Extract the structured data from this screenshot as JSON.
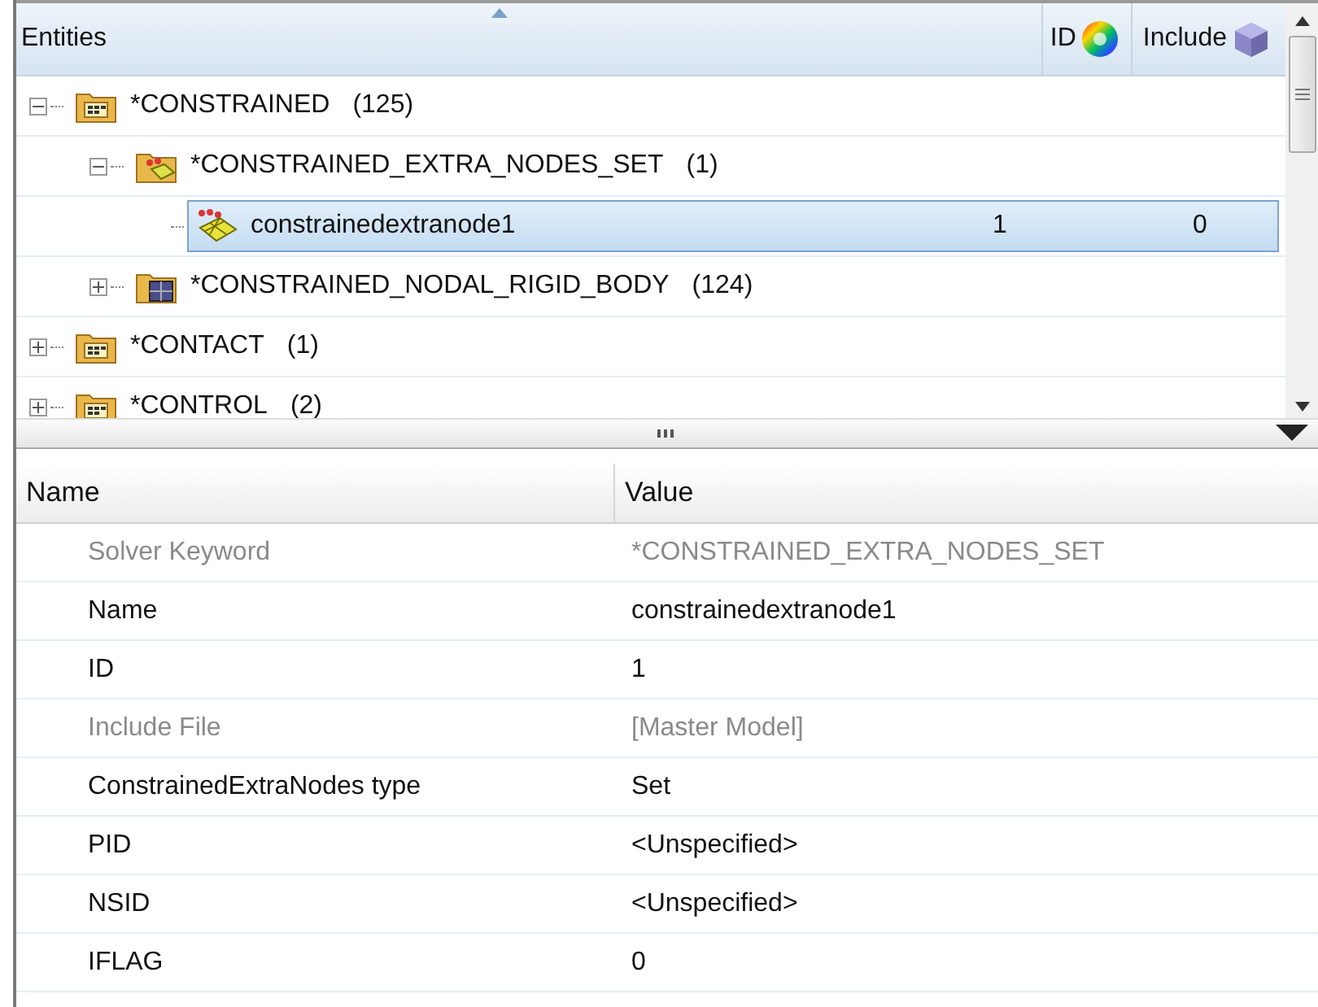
{
  "tree": {
    "columns": [
      {
        "label": "Entities",
        "sorted": true
      },
      {
        "label": "ID"
      },
      {
        "label": "Include"
      }
    ],
    "items": [
      {
        "label": "*CONSTRAINED",
        "count": "(125)",
        "kind": "folder",
        "expanded": true,
        "selected": false,
        "children": [
          {
            "label": "*CONSTRAINED_EXTRA_NODES_SET",
            "count": "(1)",
            "kind": "nodes-folder",
            "expanded": true,
            "selected": false,
            "children": [
              {
                "label": "constrainedextranode1",
                "kind": "nodes",
                "selected": true,
                "id": "1",
                "include": "0"
              }
            ]
          },
          {
            "label": "*CONSTRAINED_NODAL_RIGID_BODY",
            "count": "(124)",
            "kind": "body-folder",
            "expanded": false,
            "selected": false
          }
        ]
      },
      {
        "label": "*CONTACT",
        "count": "(1)",
        "kind": "folder",
        "expanded": false,
        "selected": false
      },
      {
        "label": "*CONTROL",
        "count": "(2)",
        "kind": "folder",
        "expanded": false,
        "selected": false
      }
    ]
  },
  "properties": {
    "columns": [
      "Name",
      "Value"
    ],
    "rows": [
      {
        "name": "Solver Keyword",
        "value": "*CONSTRAINED_EXTRA_NODES_SET",
        "disabled": true
      },
      {
        "name": "Name",
        "value": "constrainedextranode1",
        "disabled": false
      },
      {
        "name": "ID",
        "value": "1",
        "disabled": false
      },
      {
        "name": "Include File",
        "value": "[Master Model]",
        "disabled": true
      },
      {
        "name": "ConstrainedExtraNodes type",
        "value": "Set",
        "disabled": false
      },
      {
        "name": "PID",
        "value": "<Unspecified>",
        "disabled": false
      },
      {
        "name": "NSID",
        "value": "<Unspecified>",
        "disabled": false
      },
      {
        "name": "IFLAG",
        "value": "0",
        "disabled": false
      }
    ]
  }
}
